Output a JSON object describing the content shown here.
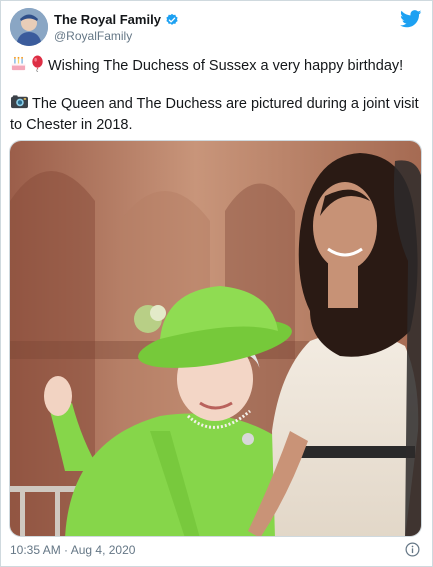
{
  "tweet": {
    "author": {
      "display_name": "The Royal Family",
      "handle": "@RoyalFamily",
      "verified": true,
      "avatar_icon": "profile-photo"
    },
    "brand_icon": "twitter-bird-icon",
    "brand_color": "#1da1f2",
    "line1": "Wishing The Duchess of Sussex a very happy birthday!",
    "line1_emojis": [
      "birthday-cake-emoji",
      "balloon-emoji"
    ],
    "line2": "The Queen and The Duchess are pictured during a joint visit to Chester in 2018.",
    "line2_emoji": "camera-emoji",
    "photo": "photo-of-the-queen-and-the-duchess",
    "timestamp": "10:35 AM · Aug 4, 2020",
    "info_icon": "info-icon"
  }
}
